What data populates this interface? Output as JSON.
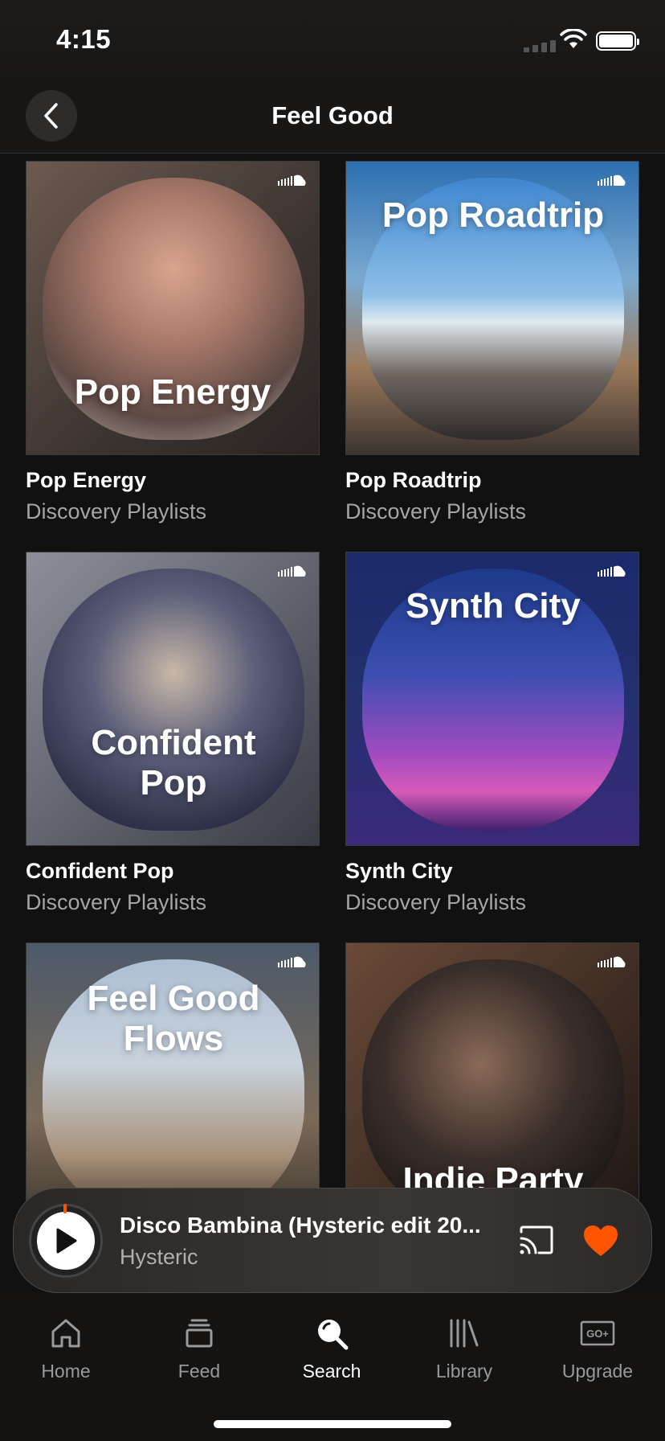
{
  "status_bar": {
    "time": "4:15"
  },
  "header": {
    "title": "Feel Good",
    "back_icon": "chevron-left-icon"
  },
  "playlists": [
    {
      "art_text": "Pop Energy",
      "title": "Pop Energy",
      "subtitle": "Discovery Playlists"
    },
    {
      "art_text": "Pop Roadtrip",
      "title": "Pop Roadtrip",
      "subtitle": "Discovery Playlists"
    },
    {
      "art_text": "Confident Pop",
      "title": "Confident Pop",
      "subtitle": "Discovery Playlists"
    },
    {
      "art_text": "Synth City",
      "title": "Synth City",
      "subtitle": "Discovery Playlists"
    },
    {
      "art_text": "Feel Good Flows",
      "title": "",
      "subtitle": ""
    },
    {
      "art_text": "Indie Party",
      "title": "",
      "subtitle": ""
    }
  ],
  "mini_player": {
    "track_title": "Disco Bambina (Hysteric edit 20...",
    "artist": "Hysteric",
    "liked": true,
    "accent_color": "#ff5500"
  },
  "tabs": [
    {
      "label": "Home",
      "icon": "home-icon",
      "active": false
    },
    {
      "label": "Feed",
      "icon": "feed-icon",
      "active": false
    },
    {
      "label": "Search",
      "icon": "search-icon",
      "active": true
    },
    {
      "label": "Library",
      "icon": "library-icon",
      "active": false
    },
    {
      "label": "Upgrade",
      "icon": "go-plus-icon",
      "active": false
    }
  ]
}
